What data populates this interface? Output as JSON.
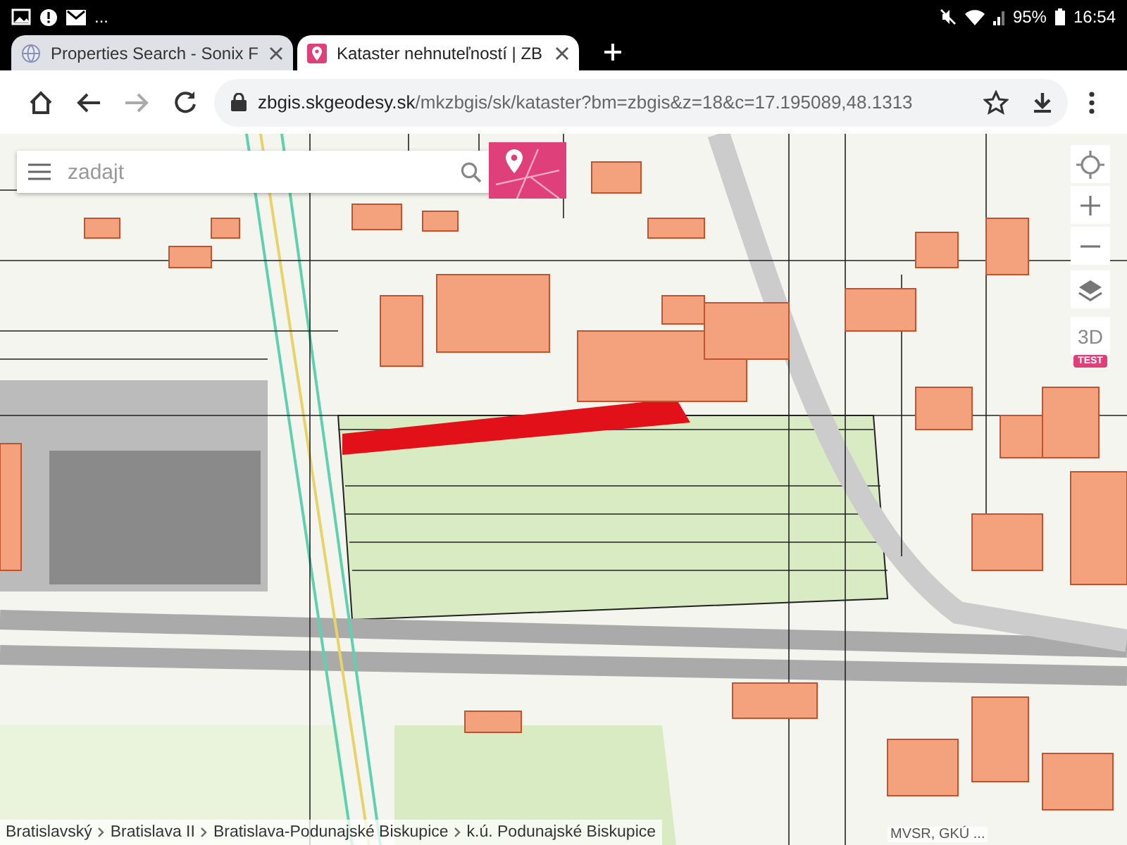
{
  "status_bar": {
    "more": "...",
    "battery": "95%",
    "time": "16:54"
  },
  "tabs": [
    {
      "title": "Properties Search - Sonix F",
      "kind": "globe",
      "selected": false
    },
    {
      "title": "Kataster nehnuteľností | ZB",
      "kind": "pin",
      "selected": true
    }
  ],
  "address_bar": {
    "host": "zbgis.skgeodesy.sk",
    "path": "/mkzbgis/sk/kataster?bm=zbgis&z=18&c=17.195089,48.1313"
  },
  "map": {
    "search": {
      "placeholder": "zadajt"
    },
    "controls": {
      "mode_3d": "3D",
      "badge": "TEST"
    },
    "breadcrumb": [
      "Bratislavský",
      "Bratislava II",
      "Bratislava-Podunajské Biskupice",
      "k.ú. Podunajské Biskupice"
    ],
    "attribution": "MVSR, GKÚ ..."
  }
}
